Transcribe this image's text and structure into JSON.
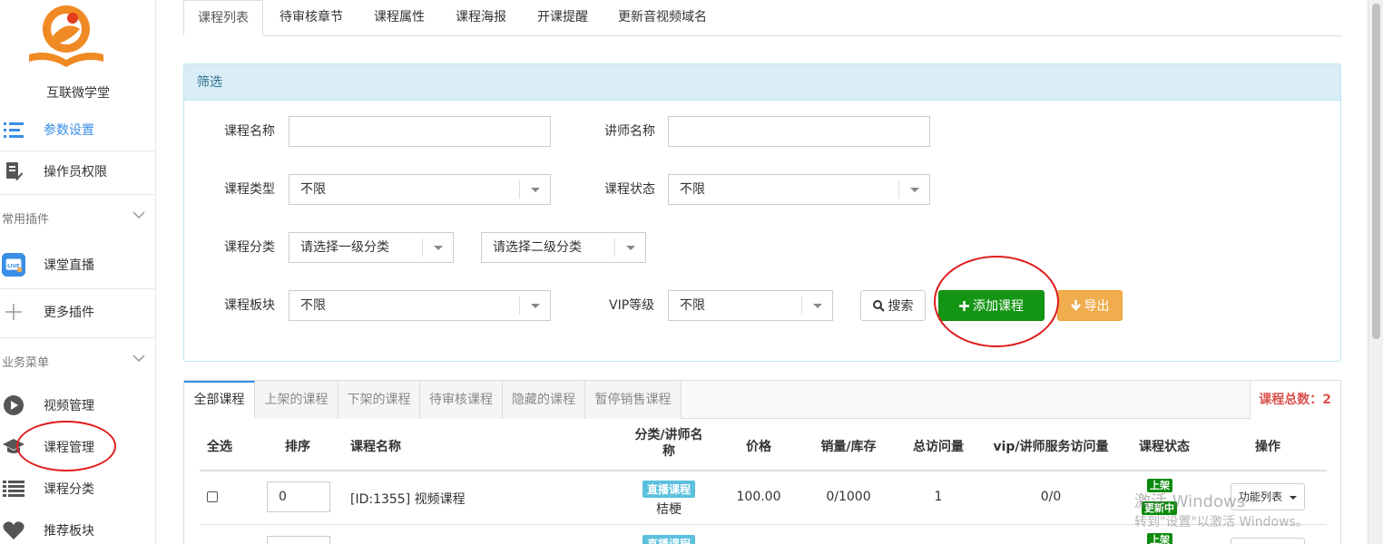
{
  "sidebar": {
    "brand": "互联微学堂",
    "items": [
      {
        "label": "参数设置",
        "icon": "list-settings-icon",
        "active": true
      },
      {
        "label": "操作员权限",
        "icon": "document-edit-icon"
      },
      {
        "label": "课堂直播",
        "icon": "live-tv-icon"
      },
      {
        "label": "更多插件",
        "icon": "plus-icon"
      },
      {
        "label": "视频管理",
        "icon": "play-circle-icon"
      },
      {
        "label": "课程管理",
        "icon": "graduation-cap-icon"
      },
      {
        "label": "课程分类",
        "icon": "list-icon"
      },
      {
        "label": "推荐板块",
        "icon": "heart-icon"
      }
    ],
    "groups": [
      "常用插件",
      "业务菜单"
    ]
  },
  "top_tabs": [
    "课程列表",
    "待审核章节",
    "课程属性",
    "课程海报",
    "开课提醒",
    "更新音视频域名"
  ],
  "filter": {
    "title": "筛选",
    "course_name_label": "课程名称",
    "teacher_name_label": "讲师名称",
    "course_type_label": "课程类型",
    "course_type_value": "不限",
    "course_status_label": "课程状态",
    "course_status_value": "不限",
    "category_label": "课程分类",
    "category1_value": "请选择一级分类",
    "category2_value": "请选择二级分类",
    "block_label": "课程板块",
    "block_value": "不限",
    "vip_label": "VIP等级",
    "vip_value": "不限",
    "search_label": "搜索",
    "add_label": "添加课程",
    "export_label": "导出"
  },
  "list": {
    "tabs": [
      "全部课程",
      "上架的课程",
      "下架的课程",
      "待审核课程",
      "隐藏的课程",
      "暂停销售课程"
    ],
    "total_label": "课程总数：",
    "total_value": "2",
    "headers": {
      "select_all": "全选",
      "order": "排序",
      "name": "课程名称",
      "category_line1": "分类/讲师名",
      "category_line2": "称",
      "price": "价格",
      "sales": "销量/库存",
      "visits": "总访问量",
      "vip_visits": "vip/讲师服务访问量",
      "status": "课程状态",
      "ops": "操作"
    },
    "rows": [
      {
        "order": "0",
        "name": "[ID:1355] 视频课程",
        "type_badge": "直播课程",
        "teacher": "桔梗",
        "price": "100.00",
        "sales": "0/1000",
        "visits": "1",
        "vip_visits": "0/0",
        "status1": "上架",
        "status2": "更新中",
        "ops": "功能列表"
      },
      {
        "type_badge": "直播课程",
        "status1": "上架"
      }
    ]
  },
  "watermark": {
    "line1": "激活 Windows",
    "line2": "转到\"设置\"以激活 Windows。"
  },
  "colors": {
    "accent": "#3a8ee6",
    "success": "#149614",
    "warning": "#f0ad4e",
    "info_bg": "#d9edf7",
    "annotation": "#e01b1b"
  }
}
